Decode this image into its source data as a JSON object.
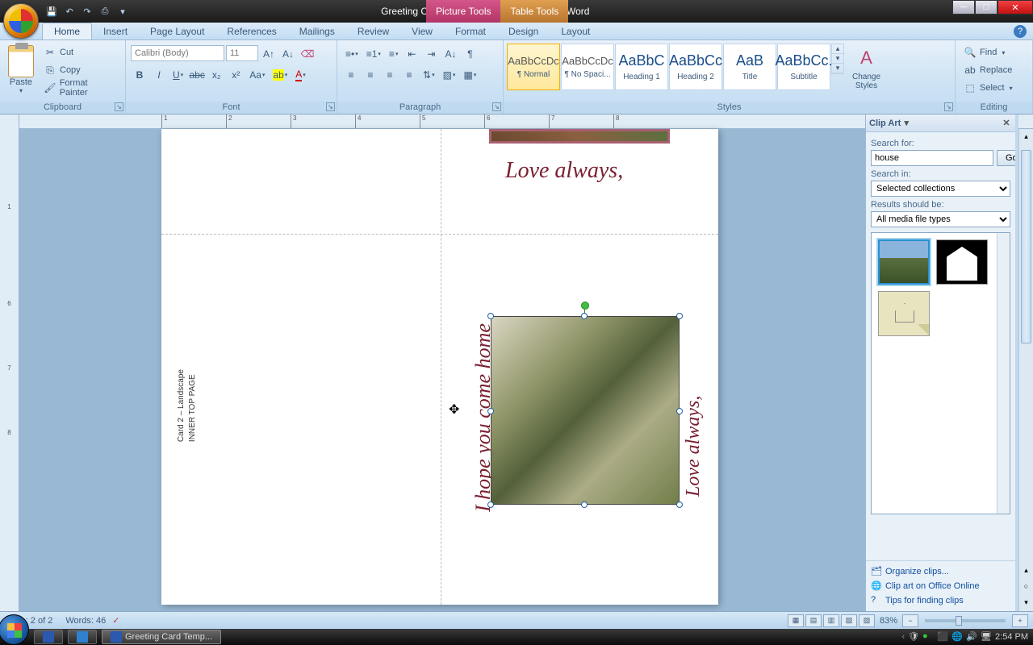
{
  "title": {
    "filename": "Greeting Card Template 2.docx",
    "app": "Microsoft Word",
    "context_picture": "Picture Tools",
    "context_table": "Table Tools"
  },
  "tabs": {
    "home": "Home",
    "insert": "Insert",
    "pagelayout": "Page Layout",
    "references": "References",
    "mailings": "Mailings",
    "review": "Review",
    "view": "View",
    "format": "Format",
    "design": "Design",
    "layout": "Layout"
  },
  "clipboard": {
    "paste": "Paste",
    "cut": "Cut",
    "copy": "Copy",
    "format_painter": "Format Painter",
    "group": "Clipboard"
  },
  "font": {
    "name": "Calibri (Body)",
    "size": "11",
    "group": "Font"
  },
  "paragraph": {
    "group": "Paragraph"
  },
  "styles": {
    "group": "Styles",
    "change_styles": "Change\nStyles",
    "items": [
      {
        "preview": "AaBbCcDc",
        "label": "¶ Normal",
        "selected": true
      },
      {
        "preview": "AaBbCcDc",
        "label": "¶ No Spaci...",
        "selected": false
      },
      {
        "preview": "AaBbC",
        "label": "Heading 1",
        "selected": false,
        "big": true
      },
      {
        "preview": "AaBbCc",
        "label": "Heading 2",
        "selected": false,
        "big": true
      },
      {
        "preview": "AaB",
        "label": "Title",
        "selected": false,
        "big": true
      },
      {
        "preview": "AaBbCc.",
        "label": "Subtitle",
        "selected": false,
        "big": true
      }
    ]
  },
  "editing": {
    "group": "Editing",
    "find": "Find",
    "replace": "Replace",
    "select": "Select"
  },
  "document": {
    "love_always": "Love always,",
    "hope_text": "I hope you come home",
    "love_always2": "Love always,",
    "card_label_1": "Card 2 – Landscape",
    "card_label_2": "INNER TOP PAGE"
  },
  "clipart": {
    "title": "Clip Art",
    "search_for": "Search for:",
    "search_value": "house",
    "go": "Go",
    "search_in": "Search in:",
    "search_in_value": "Selected collections",
    "results_label": "Results should be:",
    "results_value": "All media file types",
    "link_organize": "Organize clips...",
    "link_online": "Clip art on Office Online",
    "link_tips": "Tips for finding clips"
  },
  "statusbar": {
    "page": "Page: 2 of 2",
    "words": "Words: 46",
    "zoom": "83%"
  },
  "taskbar": {
    "task1": "Greeting Card Temp...",
    "time": "2:54 PM"
  }
}
